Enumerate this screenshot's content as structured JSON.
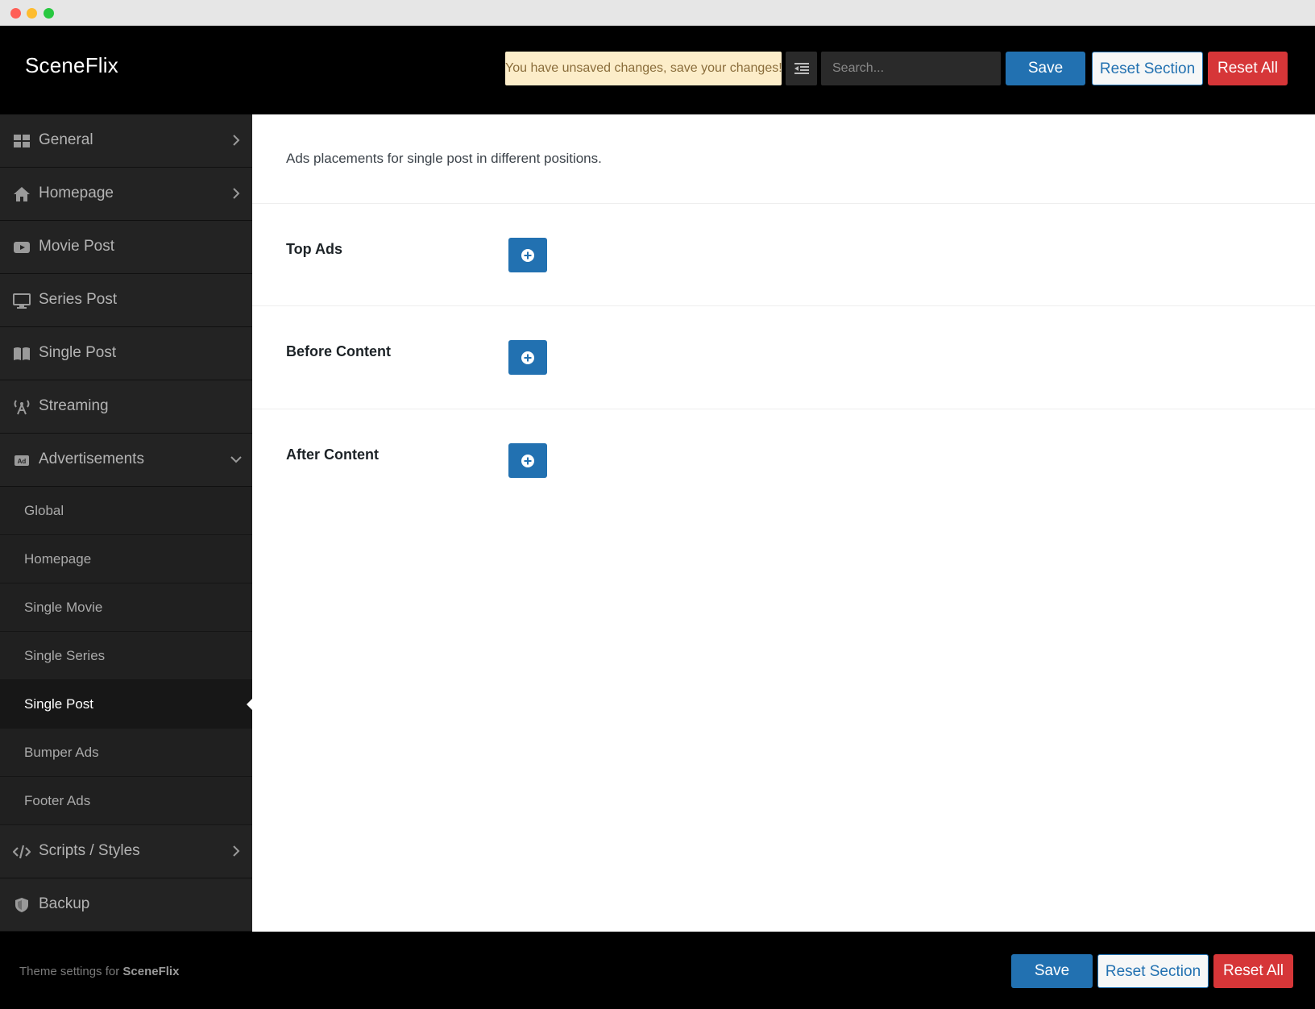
{
  "header": {
    "brand": "SceneFlix",
    "notice": "You have unsaved changes, save your changes!",
    "search_placeholder": "Search...",
    "save_label": "Save",
    "reset_section_label": "Reset Section",
    "reset_all_label": "Reset All"
  },
  "sidebar": {
    "items": [
      {
        "label": "General",
        "icon": "grid-icon"
      },
      {
        "label": "Homepage",
        "icon": "home-icon"
      },
      {
        "label": "Movie Post",
        "icon": "youtube-icon"
      },
      {
        "label": "Series Post",
        "icon": "monitor-icon"
      },
      {
        "label": "Single Post",
        "icon": "book-icon"
      },
      {
        "label": "Streaming",
        "icon": "broadcast-icon"
      },
      {
        "label": "Advertisements",
        "icon": "ad-icon"
      },
      {
        "label": "Scripts / Styles",
        "icon": "code-icon"
      },
      {
        "label": "Backup",
        "icon": "shield-icon"
      }
    ],
    "ads_subitems": [
      "Global",
      "Homepage",
      "Single Movie",
      "Single Series",
      "Single Post",
      "Bumper Ads",
      "Footer Ads"
    ],
    "active_subitem": "Single Post"
  },
  "content": {
    "description": "Ads placements for single post in different positions.",
    "fields": [
      {
        "label": "Top Ads"
      },
      {
        "label": "Before Content"
      },
      {
        "label": "After Content"
      }
    ]
  },
  "footer": {
    "text_prefix": "Theme settings for ",
    "theme_name": "SceneFlix",
    "save_label": "Save",
    "reset_section_label": "Reset Section",
    "reset_all_label": "Reset All"
  },
  "colors": {
    "primary": "#2271b1",
    "danger": "#d63638",
    "notice_bg": "#fcedc9"
  }
}
